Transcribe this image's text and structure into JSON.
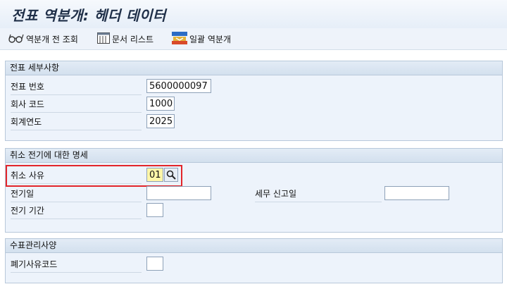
{
  "window": {
    "title": "전표 역분개: 헤더 데이터"
  },
  "toolbar": {
    "items": [
      {
        "label": "역분개 전 조회",
        "icon": "glasses-icon"
      },
      {
        "label": "문서 리스트",
        "icon": "list-icon"
      },
      {
        "label": "일괄 역분개",
        "icon": "batch-icon"
      }
    ]
  },
  "doc_details": {
    "title": "전표 세부사항",
    "doc_number": {
      "label": "전표 번호",
      "value": "5600000097"
    },
    "company_code": {
      "label": "회사 코드",
      "value": "1000"
    },
    "fiscal_year": {
      "label": "회계연도",
      "value": "2025"
    }
  },
  "reversal": {
    "title": "취소 전기에 대한 명세",
    "reason": {
      "label": "취소 사유",
      "value": "01"
    },
    "posting_date": {
      "label": "전기일",
      "value": ""
    },
    "tax_date": {
      "label": "세무 신고일",
      "value": ""
    },
    "posting_period": {
      "label": "전기 기간",
      "value": ""
    }
  },
  "check_mgmt": {
    "title": "수표관리사양",
    "void_reason": {
      "label": "폐기사유코드",
      "value": ""
    }
  },
  "colors": {
    "highlight": "#e2252a",
    "required_field": "#fff6a8"
  }
}
